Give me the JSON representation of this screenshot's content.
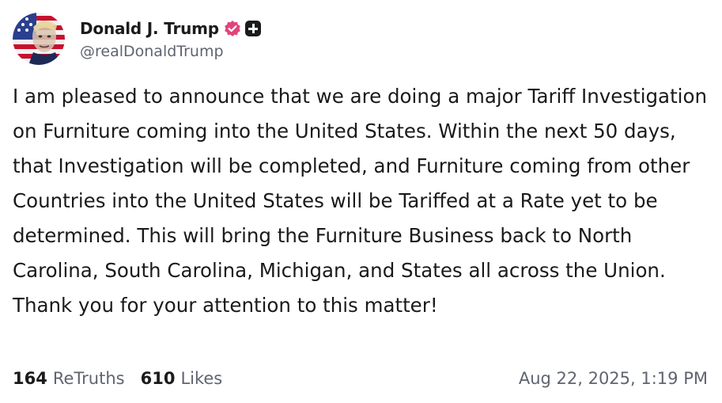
{
  "post": {
    "author": {
      "display_name": "Donald J. Trump",
      "handle": "@realDonaldTrump",
      "verified_icon": "verified-check-icon",
      "badge_icon": "plus-badge-icon",
      "verified_color": "#e0457b"
    },
    "text": "I am pleased to announce that we are doing a major Tariff Investigation on Furniture coming into the United States. Within the next 50 days, that Investigation will be completed, and Furniture coming from other Countries into the United States will be Tariffed at a Rate yet to be determined. This will bring the Furniture Business back to North Carolina, South Carolina, Michigan, and States all across the Union. Thank you for your attention to this matter!",
    "stats": {
      "retruths_count": "164",
      "retruths_label": "ReTruths",
      "likes_count": "610",
      "likes_label": "Likes"
    },
    "timestamp": "Aug 22, 2025, 1:19 PM"
  }
}
